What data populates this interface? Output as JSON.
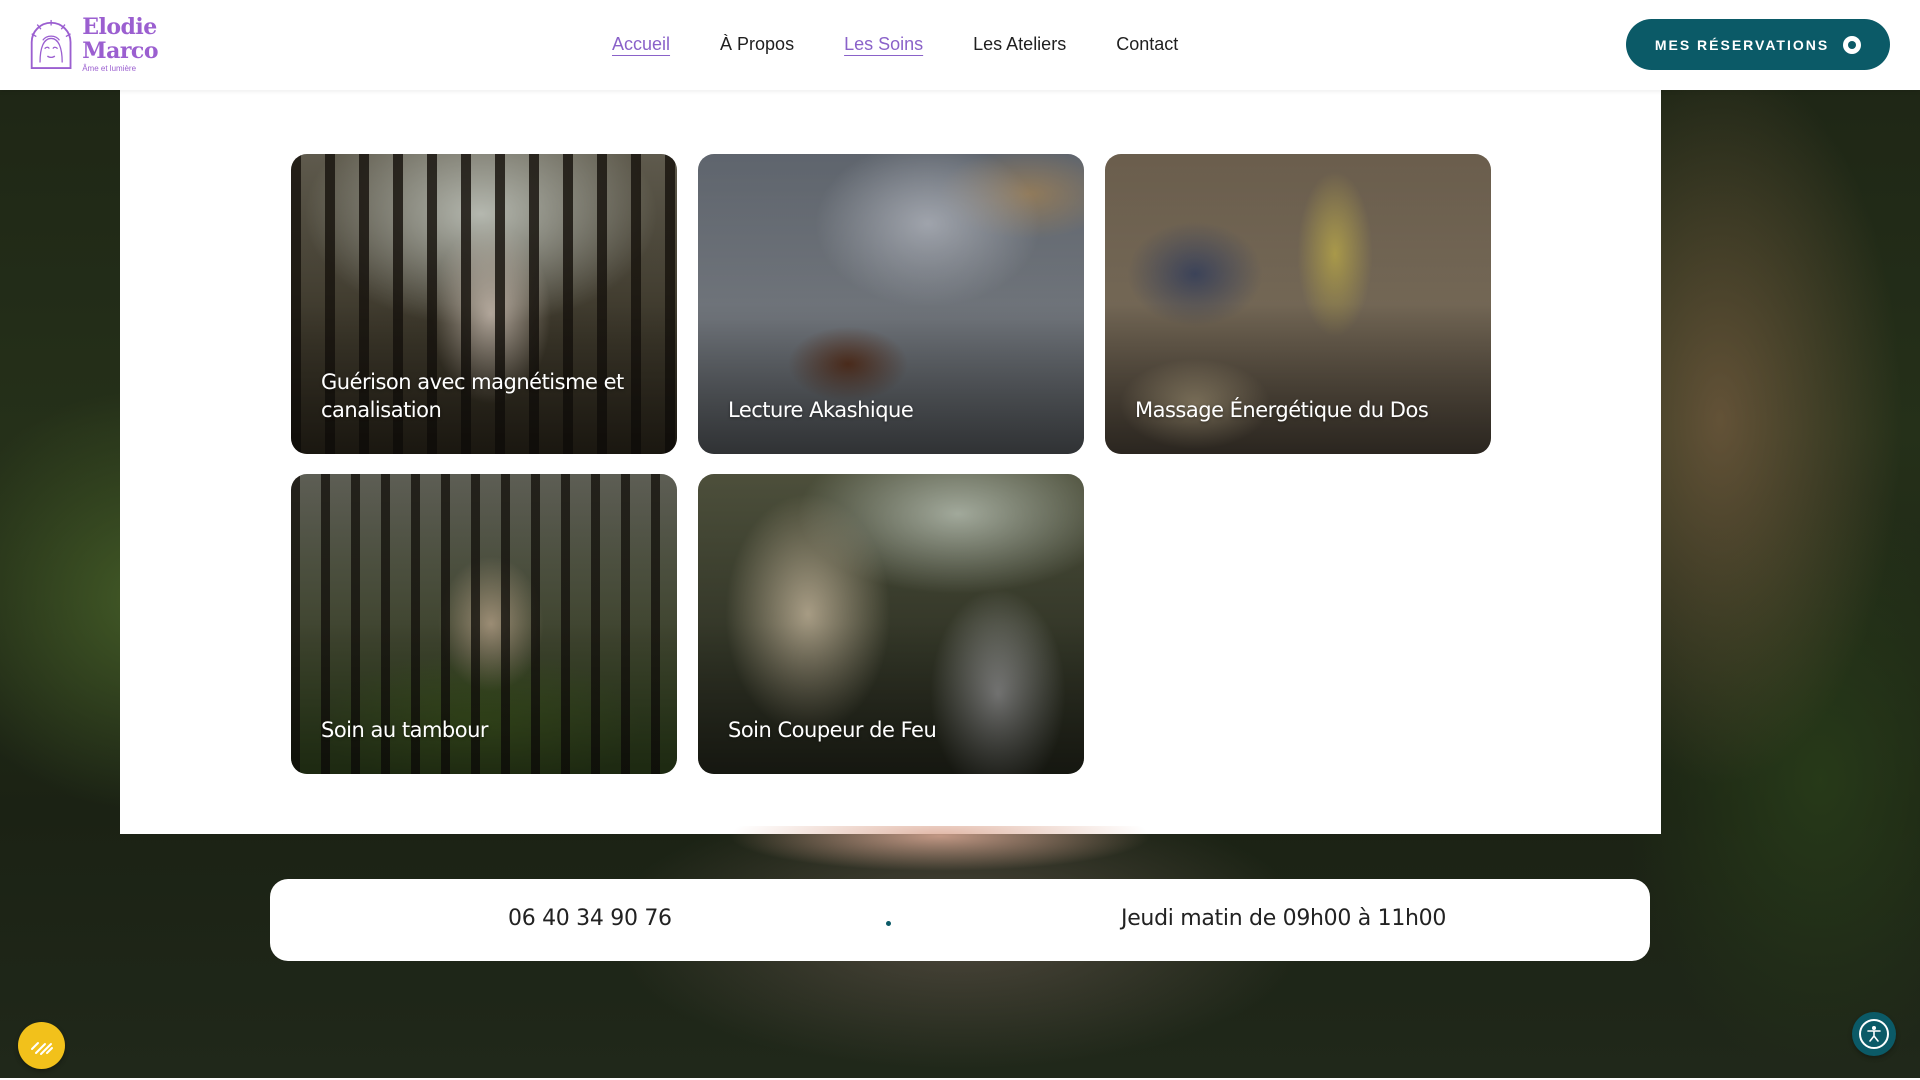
{
  "brand": {
    "name_line1": "Elodie",
    "name_line2": "Marco",
    "tagline": "Âme et lumière",
    "color": "#9b5fd0"
  },
  "nav": {
    "items": [
      {
        "label": "Accueil",
        "active": true
      },
      {
        "label": "À Propos",
        "active": false
      },
      {
        "label": "Les Soins",
        "active": true
      },
      {
        "label": "Les Ateliers",
        "active": false
      },
      {
        "label": "Contact",
        "active": false
      }
    ],
    "active_color": "#8a62c9"
  },
  "cta": {
    "label": "MES RÉSERVATIONS",
    "color": "#0b5a67"
  },
  "cards": [
    {
      "title": "Guérison avec magnétisme et canalisation"
    },
    {
      "title": "Lecture Akashique"
    },
    {
      "title": "Massage Énergétique du Dos"
    },
    {
      "title": "Soin au tambour"
    },
    {
      "title": "Soin Coupeur de Feu"
    }
  ],
  "info": {
    "phone": "06 40 34 90 76",
    "hours": "Jeudi matin de 09h00 à 11h00"
  },
  "floating": {
    "left_icon": "wand-icon",
    "left_color": "#f2c11b",
    "right_icon": "accessibility-icon",
    "right_color": "#0b5a67"
  }
}
